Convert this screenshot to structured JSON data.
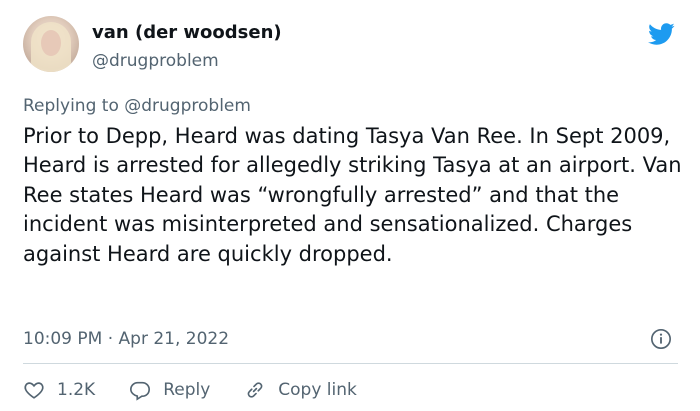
{
  "tweet": {
    "display_name": "van (der woodsen)",
    "handle": "@drugproblem",
    "replying_label": "Replying to",
    "replying_mention": "@drugproblem",
    "text": "Prior to Depp, Heard was dating Tasya Van Ree. In Sept 2009, Heard is arrested for allegedly striking Tasya at an airport. Van Ree states Heard was “wrongfully arrested” and that the incident was misinterpreted and sensationalized. Charges against Heard are quickly dropped.",
    "timestamp": "10:09 PM · Apr 21, 2022"
  },
  "actions": {
    "like_count": "1.2K",
    "reply_label": "Reply",
    "copy_link_label": "Copy link"
  },
  "colors": {
    "brand": "#1d9bf0",
    "secondary_text": "#536471",
    "divider": "#cfd9de"
  },
  "icons": [
    "avatar",
    "twitter-bird-icon",
    "info-icon",
    "heart-icon",
    "reply-icon",
    "link-icon"
  ]
}
